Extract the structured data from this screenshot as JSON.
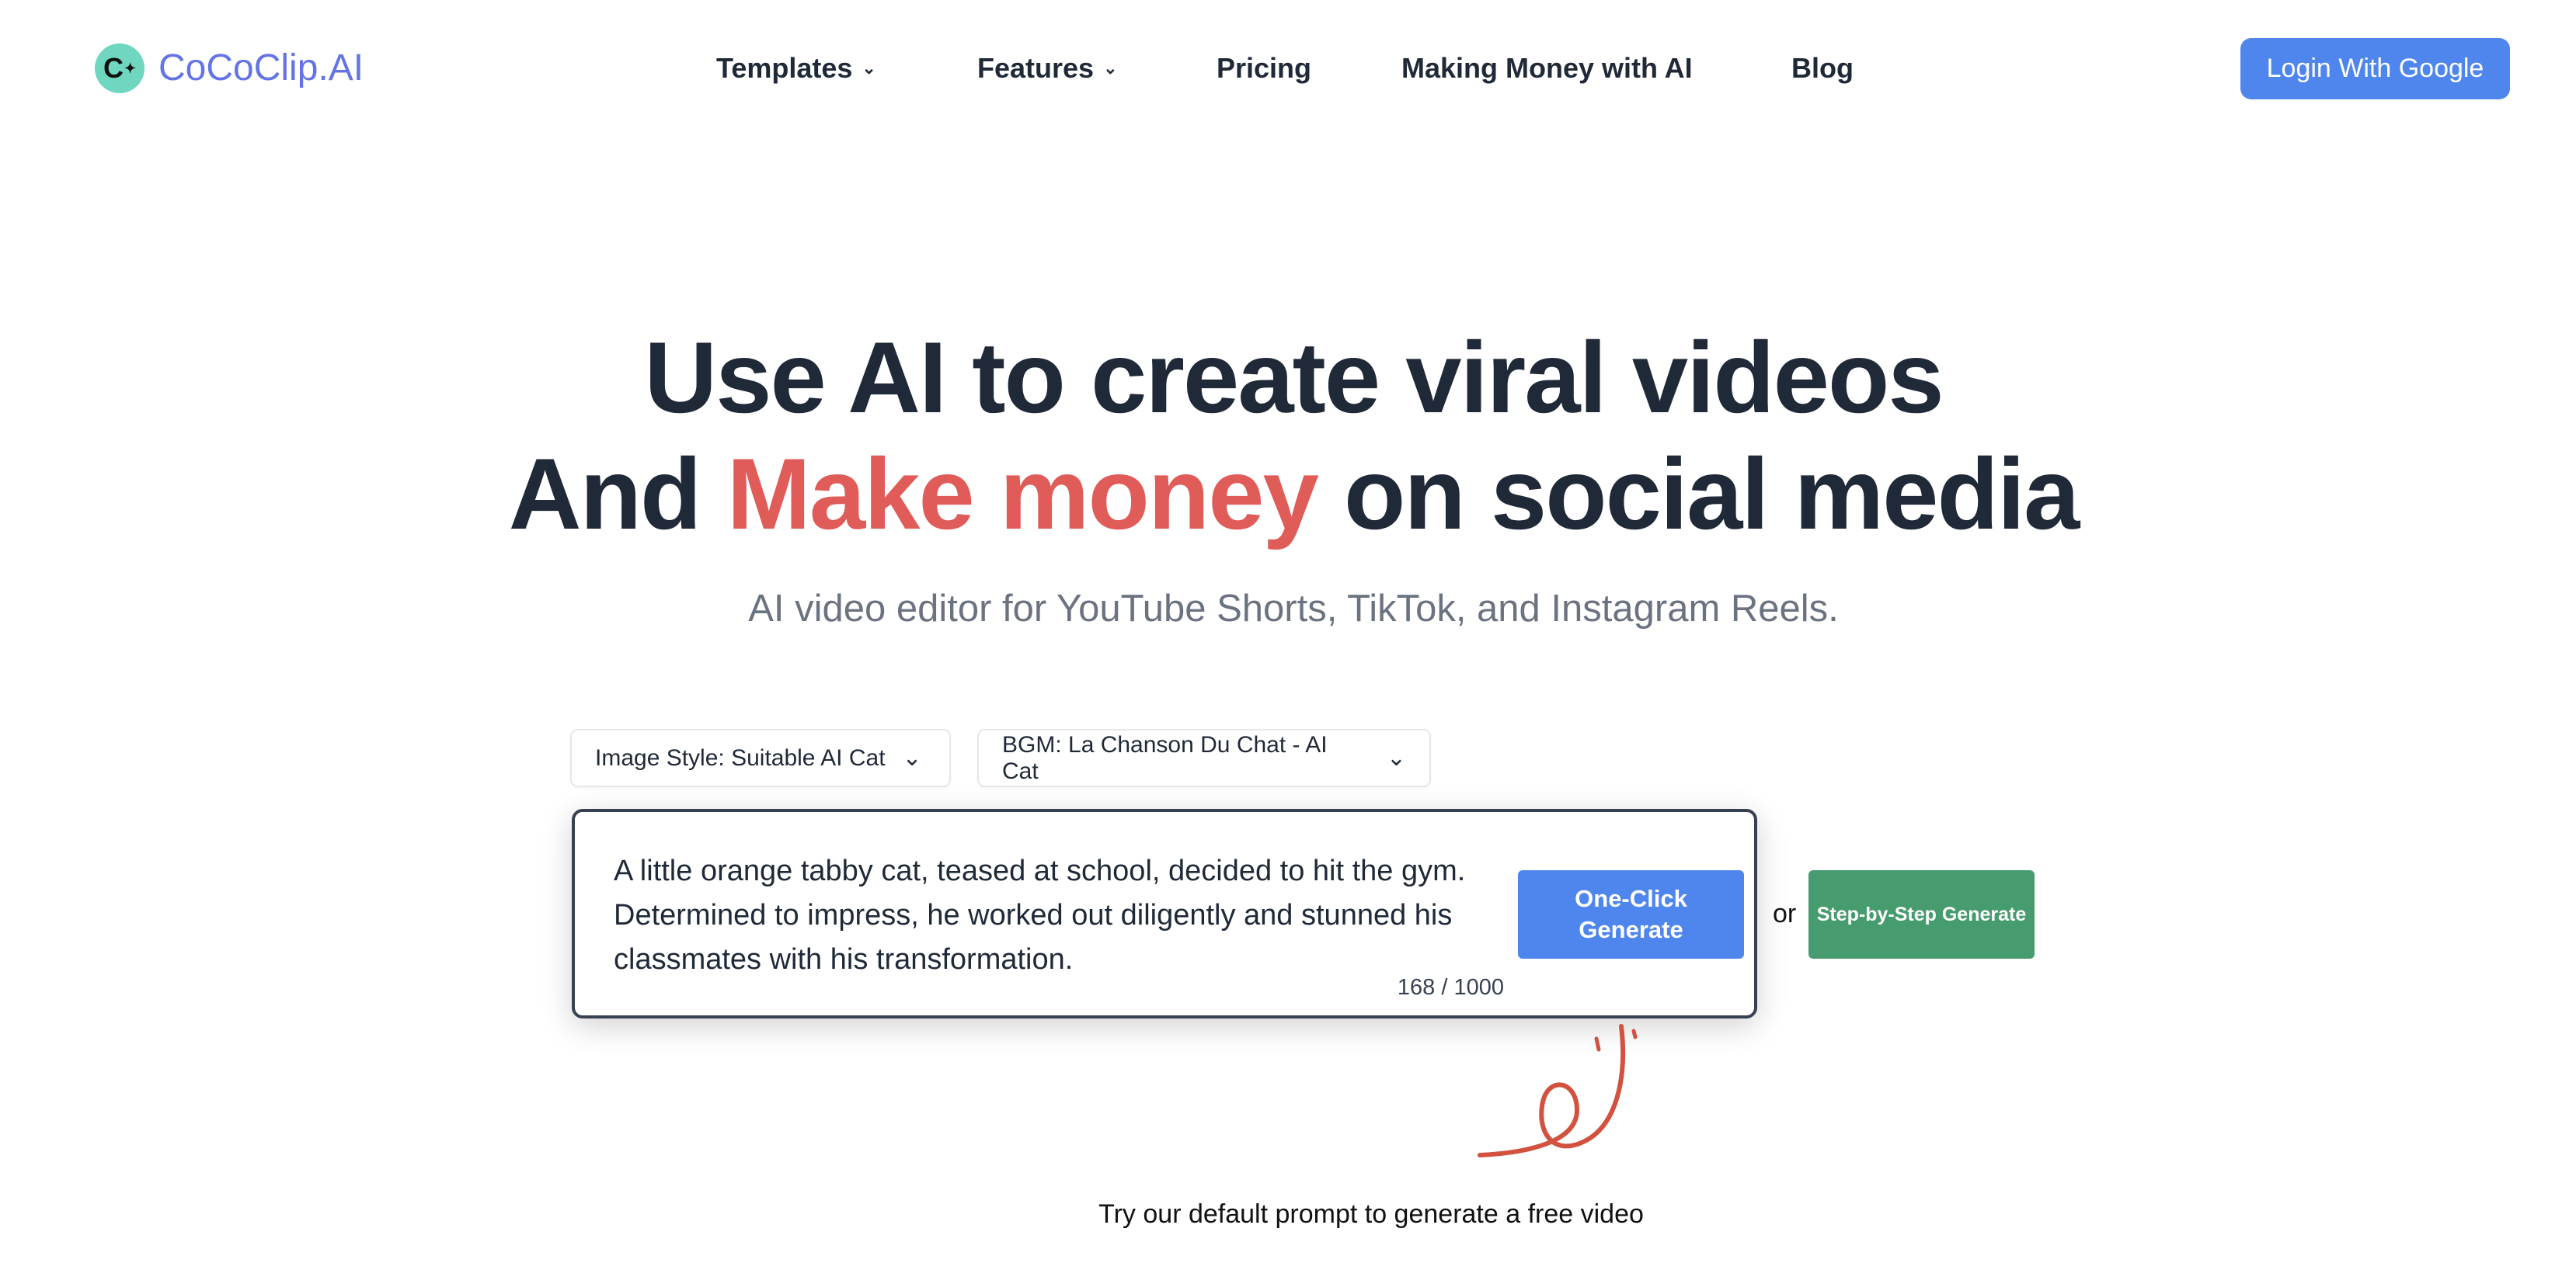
{
  "brand": {
    "name": "CoCoClip.AI",
    "logo_letter": "C",
    "color": "#6474e6"
  },
  "nav": {
    "items": [
      {
        "label": "Templates",
        "has_dropdown": true
      },
      {
        "label": "Features",
        "has_dropdown": true
      },
      {
        "label": "Pricing",
        "has_dropdown": false
      },
      {
        "label": "Making Money with AI",
        "has_dropdown": false
      },
      {
        "label": "Blog",
        "has_dropdown": false
      }
    ],
    "login_label": "Login With Google"
  },
  "hero": {
    "line1": "Use AI to create viral videos",
    "line2_pre": "And ",
    "line2_accent": "Make money",
    "line2_post": " on social media",
    "subtitle": "AI video editor for YouTube Shorts, TikTok, and Instagram Reels.",
    "accent_color": "#e05c59"
  },
  "generator": {
    "image_style": "Image Style: Suitable AI Cat",
    "bgm": "BGM: La Chanson Du Chat - AI Cat",
    "prompt": "A little orange tabby cat, teased at school, decided to hit the gym. Determined to impress, he worked out diligently and stunned his classmates with his transformation.",
    "counter": "168 / 1000",
    "one_click_label": "One-Click Generate",
    "or_label": "or",
    "step_label": "Step-by-Step Generate",
    "hint": "Try our default prompt to generate a free video"
  },
  "colors": {
    "primary": "#4f86ee",
    "secondary": "#479c6f"
  }
}
